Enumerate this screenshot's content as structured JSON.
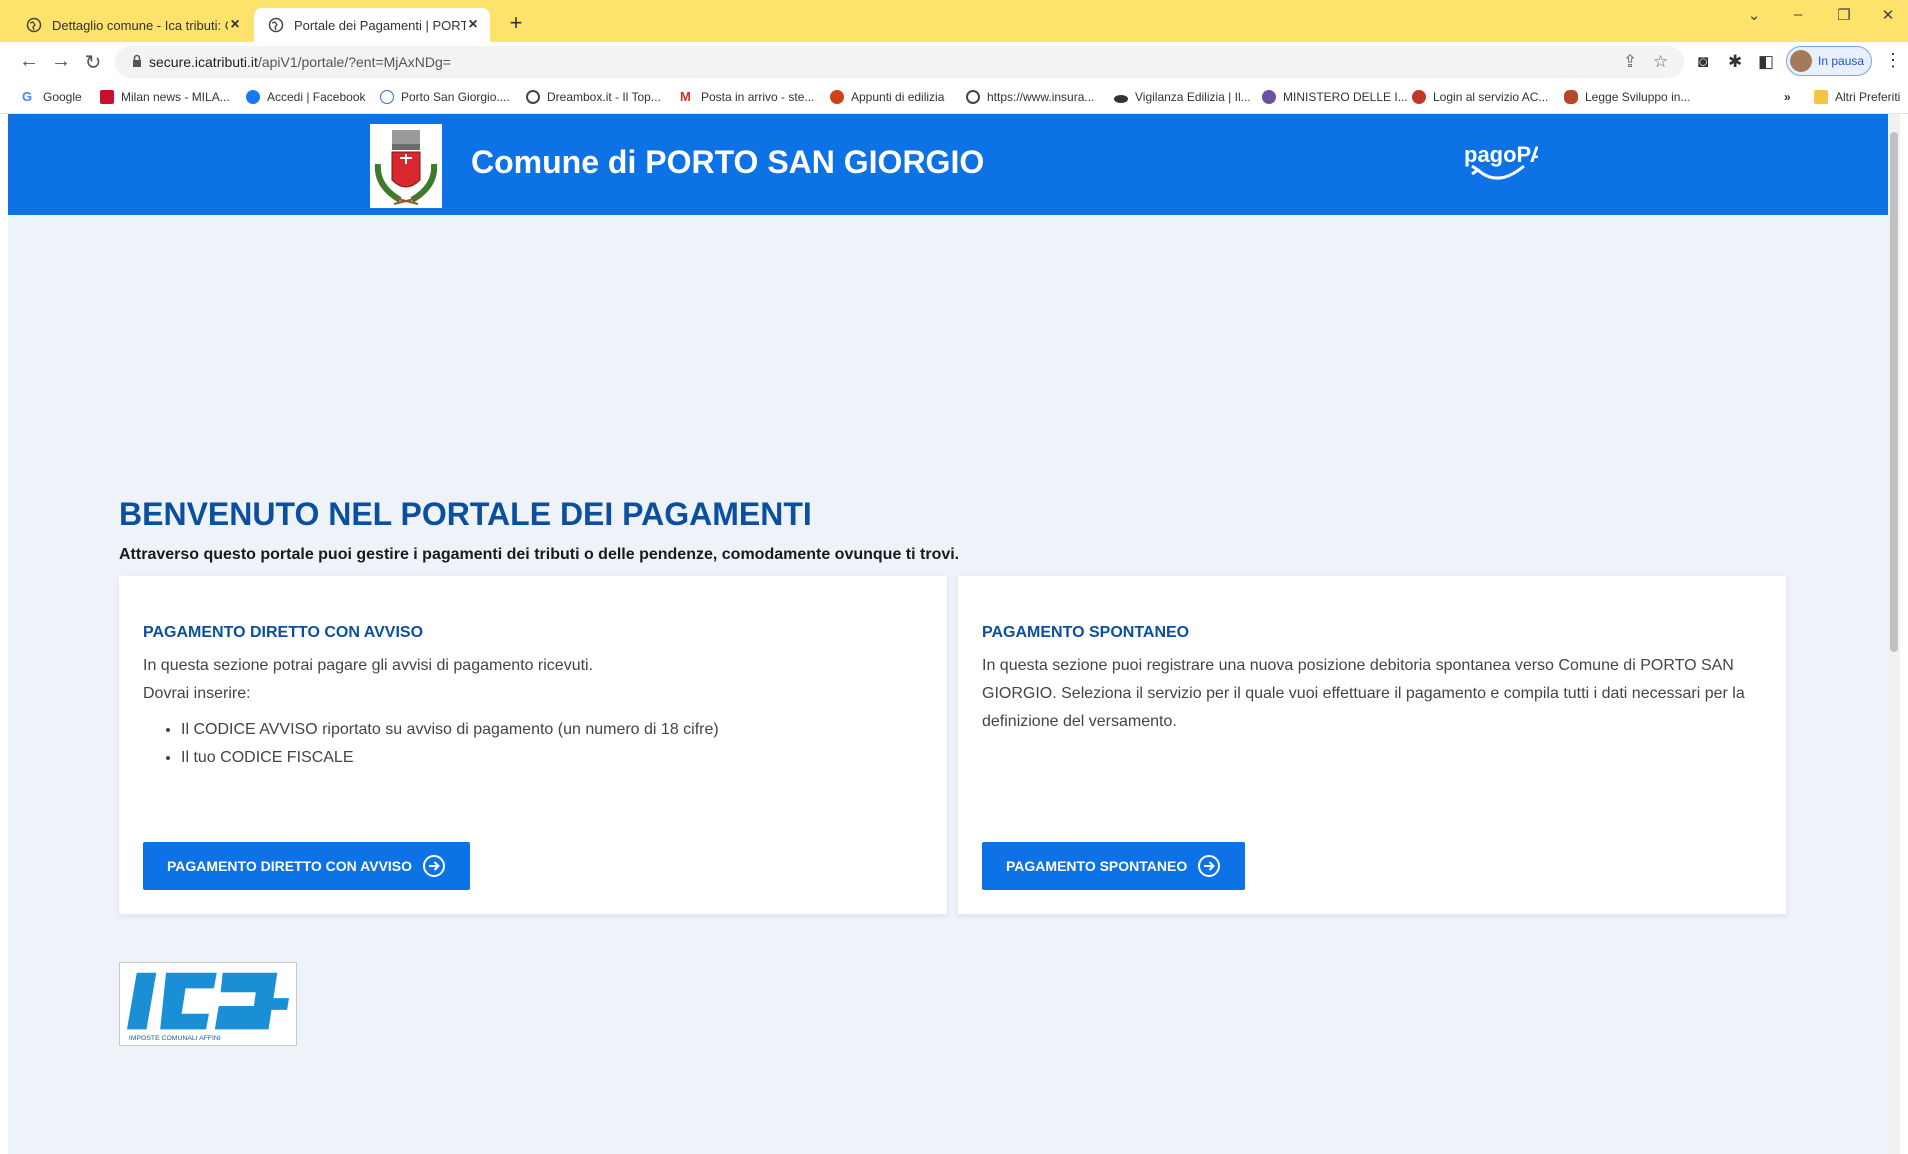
{
  "browser": {
    "tabs": [
      {
        "title": "Dettaglio comune - Ica tributi: C"
      },
      {
        "title": "Portale dei Pagamenti | PORTO S"
      }
    ],
    "url_host": "secure.icatributi.it",
    "url_path": "/apiV1/portale/?ent=MjAxNDg=",
    "profile_label": "In pausa",
    "bookmarks": [
      {
        "label": "Google"
      },
      {
        "label": "Milan news - MILA..."
      },
      {
        "label": "Accedi | Facebook"
      },
      {
        "label": "Porto San Giorgio...."
      },
      {
        "label": "Dreambox.it - Il Top..."
      },
      {
        "label": "Posta in arrivo - ste..."
      },
      {
        "label": "Appunti di edilizia"
      },
      {
        "label": "https://www.insura..."
      },
      {
        "label": "Vigilanza Edilizia | Il..."
      },
      {
        "label": "MINISTERO DELLE I..."
      },
      {
        "label": "Login al servizio AC..."
      },
      {
        "label": "Legge Sviluppo in..."
      }
    ],
    "bookmarks_overflow": "»",
    "other_bookmarks": "Altri Preferiti"
  },
  "header": {
    "title": "Comune di PORTO SAN GIORGIO",
    "pagopa_text": "pagoPA"
  },
  "main": {
    "heading": "BENVENUTO NEL PORTALE DEI PAGAMENTI",
    "subheading": "Attraverso questo portale puoi gestire i pagamenti dei tributi o delle pendenze, comodamente ovunque ti trovi.",
    "cards": [
      {
        "title": "PAGAMENTO DIRETTO CON AVVISO",
        "line1": "In questa sezione potrai pagare gli avvisi di pagamento ricevuti.",
        "line2": "Dovrai inserire:",
        "bullets": [
          "Il CODICE AVVISO riportato su avviso di pagamento (un numero di 18 cifre)",
          "Il tuo CODICE FISCALE"
        ],
        "button": "PAGAMENTO DIRETTO CON AVVISO"
      },
      {
        "title": "PAGAMENTO SPONTANEO",
        "text": "In questa sezione puoi registrare una nuova posizione debitoria spontanea verso Comune di PORTO SAN GIORGIO. Seleziona il servizio per il quale vuoi effettuare il pagamento e compila tutti i dati necessari per la definizione del versamento.",
        "button": "PAGAMENTO SPONTANEO"
      }
    ],
    "logo_caption": "IMPOSTE COMUNALI AFFINI"
  },
  "colors": {
    "header_blue": "#0c72e6",
    "heading_blue": "#0b4f9e",
    "tabbar_yellow": "#fde26c",
    "page_bg": "#edf3f9"
  }
}
